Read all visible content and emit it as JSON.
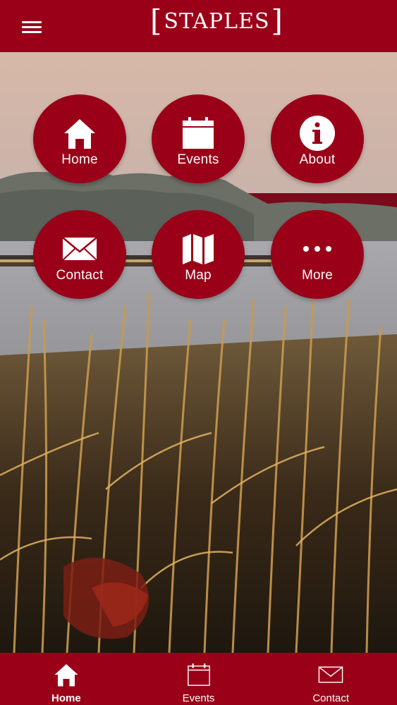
{
  "header": {
    "logo_text": "STAPLES",
    "menu_icon": "hamburger-menu-icon"
  },
  "tiles": [
    {
      "label": "Home",
      "icon": "home-icon"
    },
    {
      "label": "Events",
      "icon": "calendar-icon"
    },
    {
      "label": "About",
      "icon": "info-icon"
    },
    {
      "label": "Contact",
      "icon": "envelope-icon"
    },
    {
      "label": "Map",
      "icon": "map-icon"
    },
    {
      "label": "More",
      "icon": "more-dots-icon"
    }
  ],
  "tabbar": {
    "items": [
      {
        "label": "Home",
        "icon": "home-icon",
        "active": true
      },
      {
        "label": "Events",
        "icon": "calendar-icon",
        "active": false
      },
      {
        "label": "Contact",
        "icon": "envelope-icon",
        "active": false
      }
    ]
  },
  "colors": {
    "brand_red": "#9a0018",
    "text_white": "#ffffff"
  }
}
